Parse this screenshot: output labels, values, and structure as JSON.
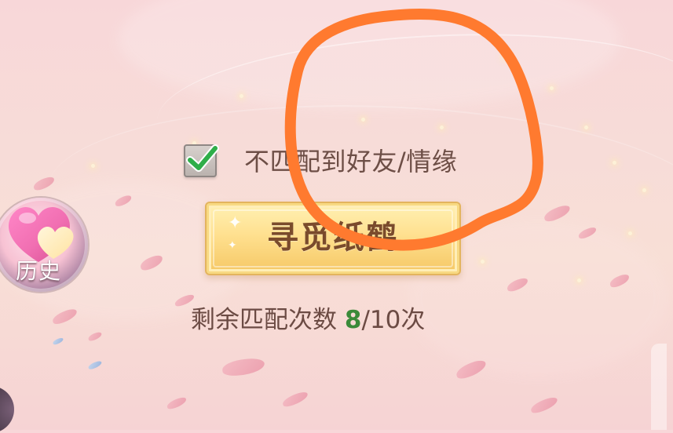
{
  "checkbox": {
    "label": "不匹配到好友/情缘",
    "checked": true
  },
  "main_button": {
    "label": "寻觅纸鹤"
  },
  "remaining": {
    "prefix": "剩余匹配次数 ",
    "current": "8",
    "suffix": "/10次"
  },
  "history": {
    "label": "历史"
  },
  "icons": {
    "checkbox_icon": "checkmark-icon",
    "history_icon": "heart-icon",
    "button_spark_icon": "sparkle-icon"
  },
  "colors": {
    "background": "#f8d7d9",
    "text": "#6d4e46",
    "button_gold": "#ffe08f",
    "button_text": "#7a4b2c",
    "accent_green": "#3a8a39",
    "annotation_orange": "#ff7a2f"
  }
}
